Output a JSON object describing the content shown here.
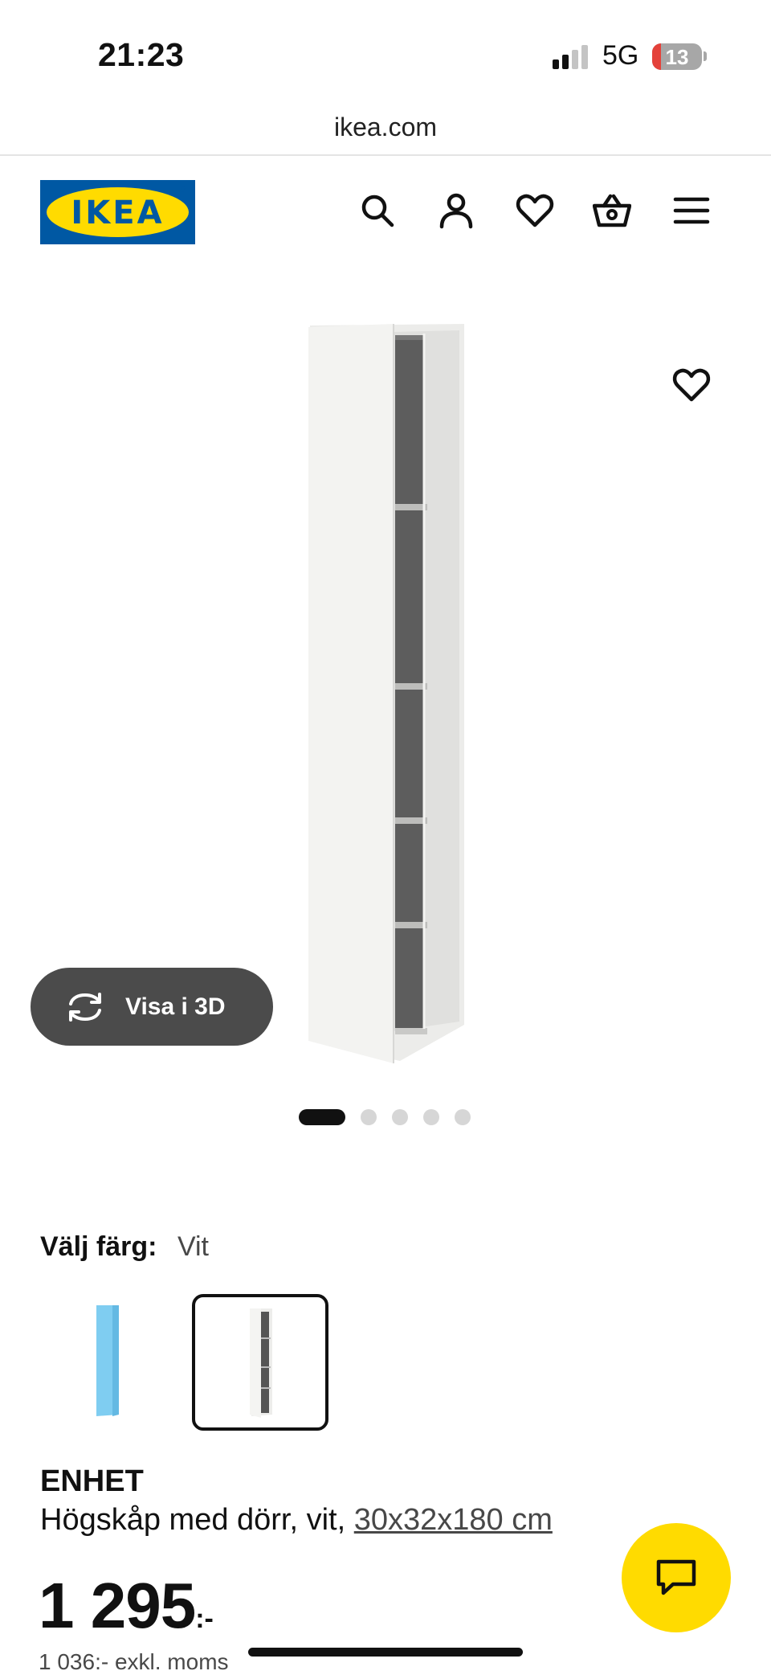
{
  "status_bar": {
    "time": "21:23",
    "network": "5G",
    "battery": "13"
  },
  "browser": {
    "url": "ikea.com"
  },
  "header": {
    "logo_text": "IKEA",
    "icons": [
      "search-icon",
      "account-icon",
      "heart-icon",
      "basket-icon",
      "menu-icon"
    ]
  },
  "gallery": {
    "view_3d_label": "Visa i 3D",
    "image_count": 5,
    "active_image": 1
  },
  "color_picker": {
    "label": "Välj färg:",
    "selected": "Vit",
    "options": [
      "blue",
      "white"
    ]
  },
  "product": {
    "name": "ENHET",
    "description": "Högskåp med dörr, vit,",
    "dimensions": "30x32x180 cm",
    "price_main": "1 295",
    "price_suffix": ":-",
    "price_ex_vat": "1 036:- exkl. moms"
  },
  "colors": {
    "ikea_blue": "#0058a3",
    "ikea_yellow": "#ffdb00",
    "dark_button": "#4b4b4b"
  }
}
